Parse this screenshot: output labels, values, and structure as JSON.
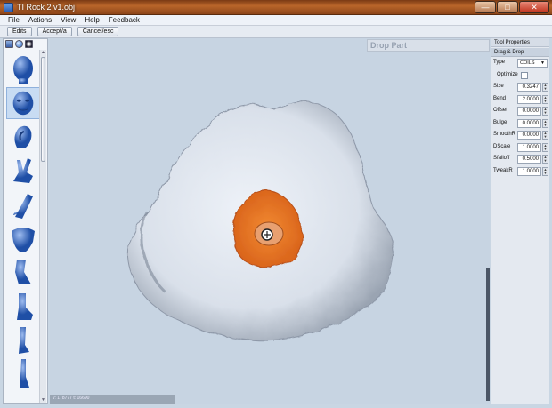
{
  "window": {
    "title": "TI Rock 2 v1.obj",
    "minimize": "—",
    "maximize": "□",
    "close": "✕"
  },
  "menu": [
    "File",
    "Actions",
    "View",
    "Help",
    "Feedback"
  ],
  "toolbar": {
    "edits": "Edits",
    "accept": "Accept/a",
    "cancel": "Cancel/esc"
  },
  "palette": {
    "tabs": [
      "mesh-tab-icon",
      "sphere-tab-icon",
      "material-tab-icon"
    ],
    "items": [
      "head-part",
      "face-part",
      "ear-part",
      "hand-part",
      "finger-part",
      "torso-part",
      "leg-part",
      "boot-part",
      "foot-part",
      "leg-lower-part",
      "limb-part"
    ],
    "selected_index": 1
  },
  "viewport": {
    "drop_panel_title": "Drop Part",
    "status_text": "v: 178777 t: 16690",
    "colors": {
      "background": "#c7d4e2",
      "rock": "#dfe5ee",
      "patch": "#e2731e"
    }
  },
  "tool_properties": {
    "header": "Tool Properties",
    "section": "Drag & Drop",
    "type_label": "Type",
    "type_value": "COILS",
    "optimize_label": "Optimize",
    "fields": [
      {
        "label": "Size",
        "value": "0.3247"
      },
      {
        "label": "Bend",
        "value": "2.0000"
      },
      {
        "label": "Offset",
        "value": "0.0000"
      },
      {
        "label": "Bulge",
        "value": "0.0000"
      },
      {
        "label": "SmoothR",
        "value": "0.0000"
      },
      {
        "label": "DScale",
        "value": "1.0000"
      },
      {
        "label": "Sfalloff",
        "value": "0.5000"
      },
      {
        "label": "TweakR",
        "value": "1.0000"
      }
    ]
  }
}
